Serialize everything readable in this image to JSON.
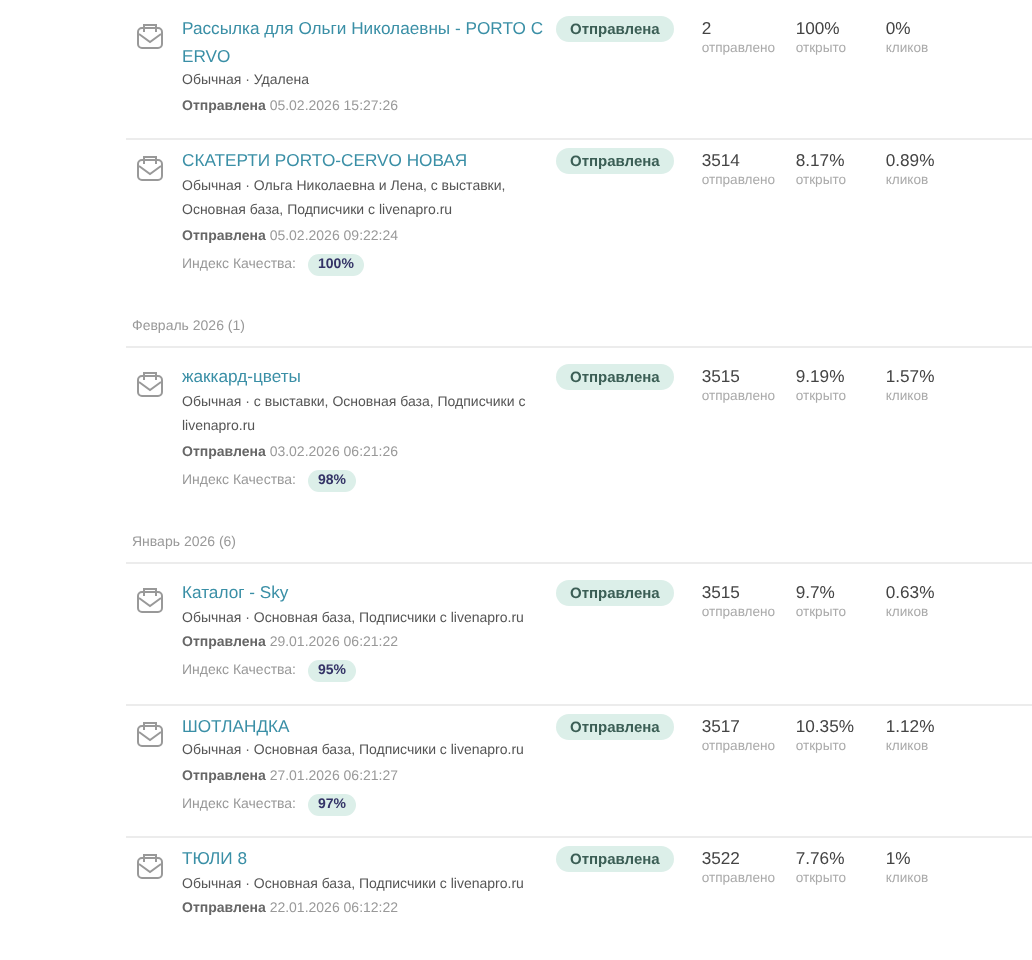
{
  "items": [
    {
      "kind": "campaign",
      "title": "Рассылка для Ольги Николаевны - PORTO CERVO",
      "meta": "Обычная · Удалена",
      "status": "Отправлена",
      "date_label": "Отправлена",
      "date": "05.02.2026 15:27:26",
      "stats": [
        {
          "value": "2",
          "label": "отправлено"
        },
        {
          "value": "100%",
          "label": "открыто"
        },
        {
          "value": "0%",
          "label": "кликов"
        }
      ]
    },
    {
      "kind": "campaign",
      "title": "СКАТЕРТИ PORTO-CERVO НОВАЯ",
      "meta": "Обычная · Ольга Николаевна и Лена, с выставки, Основная база, Подписчики с livenapro.ru",
      "status": "Отправлена",
      "date_label": "Отправлена",
      "date": "05.02.2026 09:22:24",
      "quality_label": "Индекс Качества:",
      "quality": "100%",
      "stats": [
        {
          "value": "3514",
          "label": "отправлено"
        },
        {
          "value": "8.17%",
          "label": "открыто"
        },
        {
          "value": "0.89%",
          "label": "кликов"
        }
      ]
    },
    {
      "kind": "group",
      "label": "Февраль 2026 (1)"
    },
    {
      "kind": "campaign",
      "title": "жаккард-цветы",
      "meta": "Обычная · с выставки, Основная база, Подписчики с livenapro.ru",
      "status": "Отправлена",
      "date_label": "Отправлена",
      "date": "03.02.2026 06:21:26",
      "quality_label": "Индекс Качества:",
      "quality": "98%",
      "stats": [
        {
          "value": "3515",
          "label": "отправлено"
        },
        {
          "value": "9.19%",
          "label": "открыто"
        },
        {
          "value": "1.57%",
          "label": "кликов"
        }
      ]
    },
    {
      "kind": "group",
      "label": "Январь 2026 (6)"
    },
    {
      "kind": "campaign",
      "title": "Каталог - Sky",
      "meta": "Обычная · Основная база, Подписчики с livenapro.ru",
      "status": "Отправлена",
      "date_label": "Отправлена",
      "date": "29.01.2026 06:21:22",
      "quality_label": "Индекс Качества:",
      "quality": "95%",
      "stats": [
        {
          "value": "3515",
          "label": "отправлено"
        },
        {
          "value": "9.7%",
          "label": "открыто"
        },
        {
          "value": "0.63%",
          "label": "кликов"
        }
      ]
    },
    {
      "kind": "campaign",
      "title": "ШОТЛАНДКА",
      "meta": "Обычная · Основная база, Подписчики с livenapro.ru",
      "status": "Отправлена",
      "date_label": "Отправлена",
      "date": "27.01.2026 06:21:27",
      "quality_label": "Индекс Качества:",
      "quality": "97%",
      "stats": [
        {
          "value": "3517",
          "label": "отправлено"
        },
        {
          "value": "10.35%",
          "label": "открыто"
        },
        {
          "value": "1.12%",
          "label": "кликов"
        }
      ]
    },
    {
      "kind": "campaign",
      "title": "ТЮЛИ 8",
      "meta": "Обычная · Основная база, Подписчики с livenapro.ru",
      "status": "Отправлена",
      "date_label": "Отправлена",
      "date": "22.01.2026 06:12:22",
      "stats": [
        {
          "value": "3522",
          "label": "отправлено"
        },
        {
          "value": "7.76%",
          "label": "открыто"
        },
        {
          "value": "1%",
          "label": "кликов"
        }
      ]
    }
  ]
}
